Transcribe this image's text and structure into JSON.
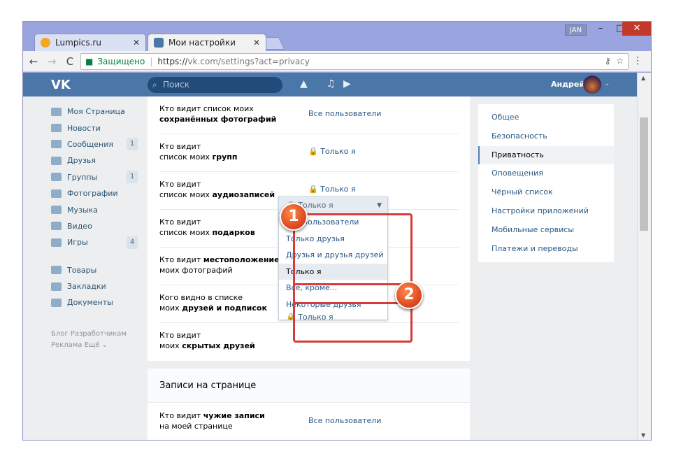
{
  "tabs": [
    {
      "title": "Lumpics.ru",
      "active": false
    },
    {
      "title": "Мои настройки",
      "active": true
    }
  ],
  "window": {
    "user_badge": "JAN",
    "minimize": "–",
    "maximize": "□",
    "close": "✕"
  },
  "toolbar": {
    "back": "←",
    "forward": "→",
    "reload": "C",
    "secure_label": "Защищено",
    "url_scheme": "https://",
    "url_rest": "vk.com/settings?act=privacy",
    "key": "⚷",
    "star": "☆",
    "menu": "⋮"
  },
  "vk": {
    "logo": "VK",
    "search_placeholder": "Поиск",
    "user_name": "Андрей"
  },
  "left_nav": [
    {
      "label": "Моя Страница",
      "count": ""
    },
    {
      "label": "Новости",
      "count": ""
    },
    {
      "label": "Сообщения",
      "count": "1"
    },
    {
      "label": "Друзья",
      "count": ""
    },
    {
      "label": "Группы",
      "count": "1"
    },
    {
      "label": "Фотографии",
      "count": ""
    },
    {
      "label": "Музыка",
      "count": ""
    },
    {
      "label": "Видео",
      "count": ""
    },
    {
      "label": "Игры",
      "count": "4"
    },
    {
      "label": "Товары",
      "count": ""
    },
    {
      "label": "Закладки",
      "count": ""
    },
    {
      "label": "Документы",
      "count": ""
    }
  ],
  "footer": {
    "line1": "Блог   Разработчикам",
    "line2": "Реклама   Ещё ⌄"
  },
  "settings_rows": [
    {
      "q1": "Кто видит список моих",
      "q2b": "сохранённых фотографий",
      "value": "Все пользователи"
    },
    {
      "q1": "Кто видит",
      "q2": "список моих ",
      "q2b": "групп",
      "value": "🔒 Только я"
    },
    {
      "q1": "Кто видит",
      "q2": "список моих ",
      "q2b": "аудиозаписей",
      "value": "🔒 Только я"
    },
    {
      "q1": "Кто видит",
      "q2": "список моих ",
      "q2b": "подарков",
      "value": ""
    },
    {
      "q1": "Кто видит ",
      "q1b": "местоположение",
      "q2": "моих фотографий",
      "value": ""
    },
    {
      "q1": "Кого видно в списке",
      "q2": "моих ",
      "q2b": "друзей и подписок",
      "value": ""
    },
    {
      "q1": "Кто видит",
      "q2": "моих ",
      "q2b": "скрытых друзей",
      "value": ""
    }
  ],
  "section2": {
    "title": "Записи на странице",
    "row": {
      "q1": "Кто видит ",
      "q1b": "чужие записи",
      "q2": "на моей странице",
      "value": "Все пользователи"
    }
  },
  "right_nav": [
    "Общее",
    "Безопасность",
    "Приватность",
    "Оповещения",
    "Чёрный список",
    "Настройки приложений",
    "Мобильные сервисы",
    "Платежи и переводы"
  ],
  "right_nav_selected": "Приватность",
  "dropdown": {
    "current": "🔒 Только я",
    "options": [
      "Все пользователи",
      "Только друзья",
      "Друзья и друзья друзей",
      "Только я",
      "Все, кроме...",
      "Некоторые друзья",
      "🔒 Только я"
    ],
    "highlighted": "Только я"
  },
  "markers": [
    "1",
    "2"
  ]
}
